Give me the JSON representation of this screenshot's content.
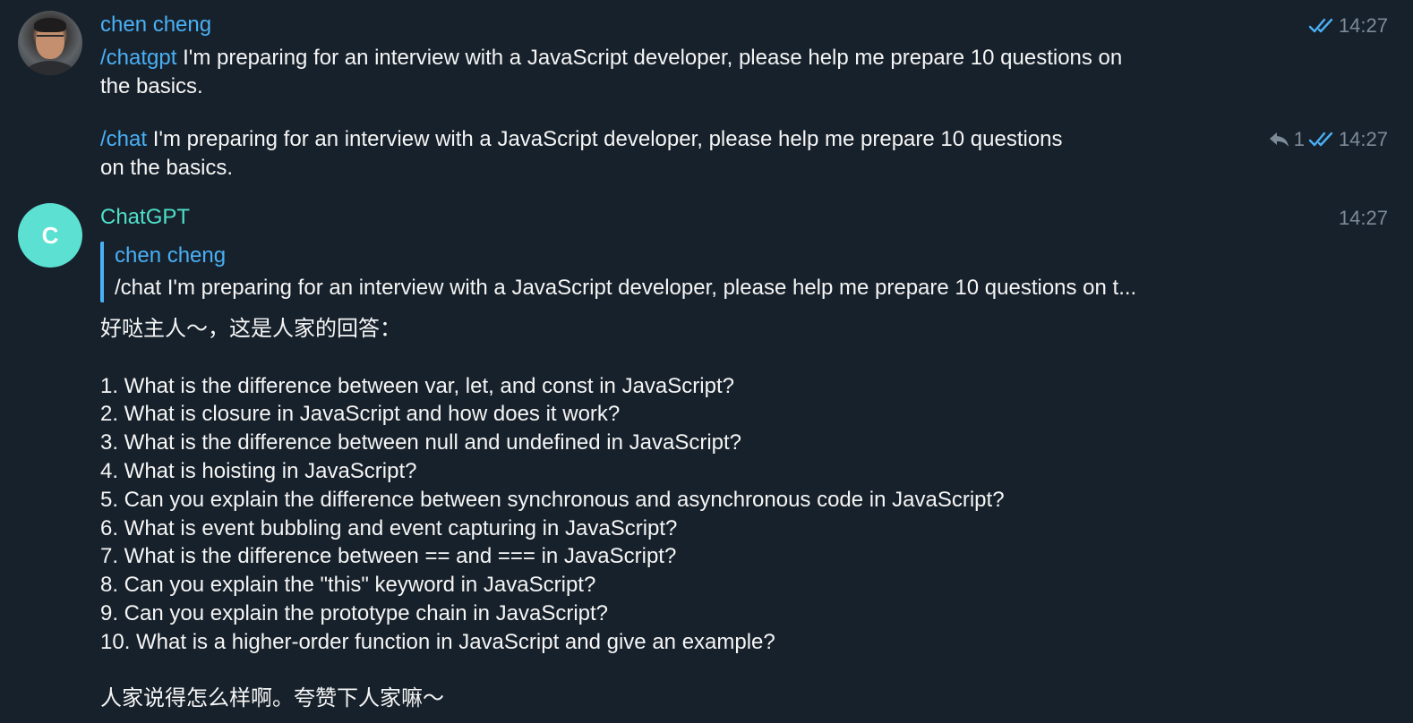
{
  "messages": [
    {
      "sender": "chen cheng",
      "command": "/chatgpt",
      "text_line1": " I'm preparing for an interview with a JavaScript developer, please help me prepare 10 questions on",
      "text_line2": "the basics.",
      "time": "14:27"
    },
    {
      "command": "/chat",
      "text_line1": " I'm preparing for an interview with a JavaScript developer, please help me prepare 10 questions",
      "text_line2": "on the basics.",
      "reply_count": "1",
      "time": "14:27"
    },
    {
      "sender": "ChatGPT",
      "avatar_letter": "C",
      "time": "14:27",
      "quote": {
        "name": "chen cheng",
        "text": "/chat I'm preparing for an interview with a JavaScript developer, please help me prepare 10 questions on t..."
      },
      "intro": "好哒主人～，这是人家的回答：",
      "questions": [
        "1. What is the difference between var, let, and const in JavaScript?",
        "2. What is closure in JavaScript and how does it work?",
        "3. What is the difference between null and undefined in JavaScript?",
        "4. What is hoisting in JavaScript?",
        "5. Can you explain the difference between synchronous and asynchronous code in JavaScript?",
        "6. What is event bubbling and event capturing in JavaScript?",
        "7. What is the difference between == and === in JavaScript?",
        "8. Can you explain the \"this\" keyword in JavaScript?",
        "9. Can you explain the prototype chain in JavaScript?",
        "10. What is a higher-order function in JavaScript and give an example?"
      ],
      "outro": "人家说得怎么样啊。夸赞下人家嘛～"
    }
  ],
  "colors": {
    "background": "#17212b",
    "link": "#4ab0f5",
    "bot_name": "#4ee0c8",
    "bot_avatar": "#5ce0d2",
    "meta": "#7d8b99"
  },
  "icons": {
    "read_status": "double-check-icon",
    "reply": "reply-arrow-icon",
    "user_avatar": "avatar-photo"
  }
}
